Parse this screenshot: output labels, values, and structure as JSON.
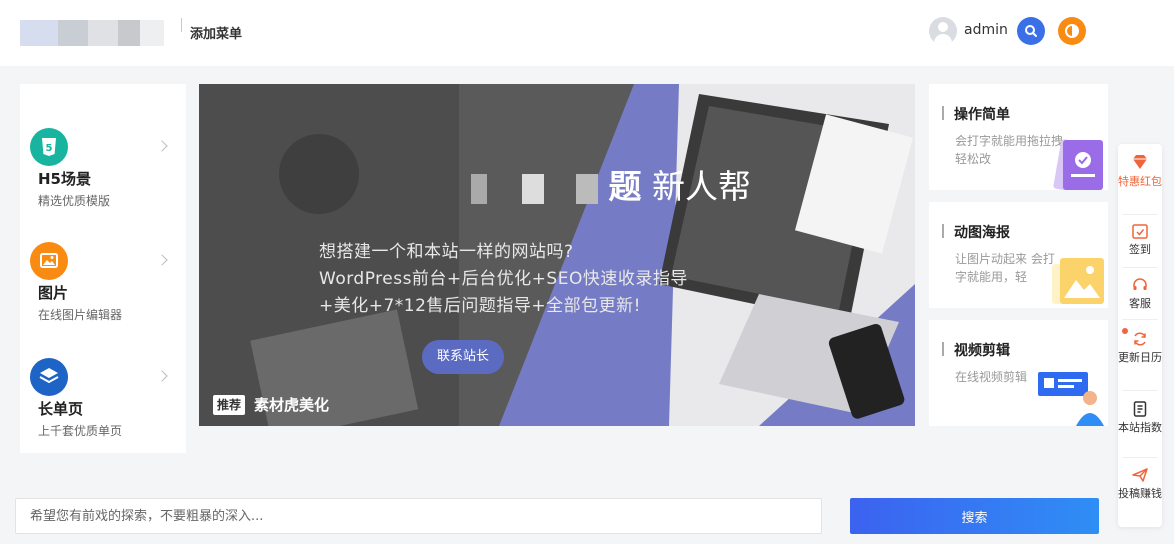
{
  "header": {
    "nav_label": "添加菜单",
    "username": "admin"
  },
  "left_panel": {
    "items": [
      {
        "title": "H5场景",
        "subtitle": "精选优质模版",
        "icon": "html5-icon",
        "color": "#18b4a0"
      },
      {
        "title": "图片",
        "subtitle": "在线图片编辑器",
        "icon": "image-icon",
        "color": "#f98a12"
      },
      {
        "title": "长单页",
        "subtitle": "上千套优质单页",
        "icon": "layers-icon",
        "color": "#1e63c6"
      }
    ]
  },
  "banner": {
    "title_visible": "题",
    "title_rest": "新人帮",
    "text_line1": "想搭建一个和本站一样的网站吗?",
    "text_line2": "WordPress前台+后台优化+SEO快速收录指导",
    "text_line3": "+美化+7*12售后问题指导+全部包更新!",
    "cta_label": "联系站长",
    "tag": "推荐",
    "caption": "素材虎美化"
  },
  "cards": [
    {
      "title": "操作简单",
      "desc": "会打字就能用拖拉拽轻松改"
    },
    {
      "title": "动图海报",
      "desc": "让图片动起来 会打字就能用，轻"
    },
    {
      "title": "视频剪辑",
      "desc": "在线视频剪辑"
    }
  ],
  "float_bar": {
    "items": [
      {
        "label": "特惠红包",
        "icon": "diamond-icon",
        "color": "#f0653a"
      },
      {
        "label": "签到",
        "icon": "calendar-check-icon",
        "color": "#f0653a"
      },
      {
        "label": "客服",
        "icon": "headset-icon",
        "color": "#f0653a"
      },
      {
        "label": "更新日历",
        "icon": "refresh-icon",
        "color": "#f0653a"
      },
      {
        "label": "本站指数",
        "icon": "document-icon",
        "color": "#333333"
      },
      {
        "label": "投稿赚钱",
        "icon": "paper-plane-icon",
        "color": "#f0653a"
      }
    ]
  },
  "search": {
    "placeholder": "希望您有前戏的探索，不要粗暴的深入...",
    "button_label": "搜索"
  },
  "colors": {
    "accent_blue": "#3b6fe8",
    "accent_orange": "#f98a12",
    "float_accent": "#f0653a"
  }
}
